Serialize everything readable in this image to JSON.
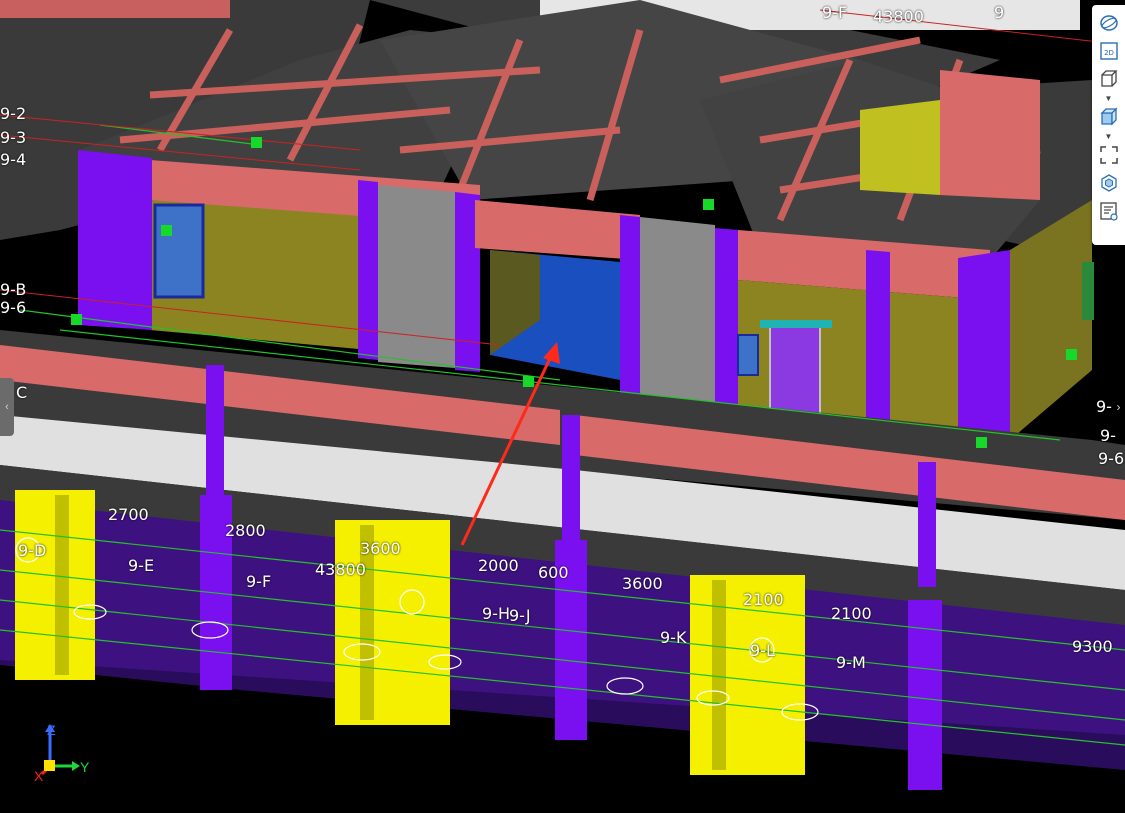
{
  "grid_labels": {
    "top_f": "9-F",
    "top_dim": "43800",
    "top_9": "9",
    "left_2": "9-2",
    "left_3": "9-3",
    "left_4": "9-4",
    "left_b": "9-B",
    "left_6": "9-6",
    "left_c": "C",
    "right_9": "9-",
    "right_9b": "9-",
    "right_6": "9-6",
    "bottom_d": "9-D",
    "bottom_e": "9-E",
    "bottom_f": "9-F",
    "bottom_h": "9-H",
    "bottom_j": "9-J",
    "bottom_k": "9-K",
    "bottom_m": "9-M",
    "bottom_l": "9-L"
  },
  "dimensions": {
    "d2700": "2700",
    "d2800": "2800",
    "d3600a": "3600",
    "d43800": "43800",
    "d2000": "2000",
    "d600": "600",
    "d3600b": "3600",
    "d2100a": "2100",
    "d2100b": "2100",
    "d9300": "9300"
  },
  "toolbar": {
    "items": [
      {
        "icon": "orbit-icon"
      },
      {
        "icon": "view-2d-icon",
        "label": "2D"
      },
      {
        "icon": "cube-wireframe-icon"
      },
      {
        "icon": "cube-shaded-icon"
      },
      {
        "icon": "fit-view-icon"
      },
      {
        "icon": "section-box-icon"
      },
      {
        "icon": "properties-panel-icon"
      }
    ]
  },
  "axes": {
    "z": "Z",
    "y": "Y",
    "x": "X"
  },
  "colors": {
    "background": "#000000",
    "slab": "#3f3f3f",
    "beam": "#d96a6a",
    "column": "#7a10f0",
    "wall": "#8c8420",
    "opening_blue": "#1a4fc0",
    "lower_wall": "#4a1290",
    "yellow_column": "#f4f000",
    "grid_line": "#22c22a",
    "marker": "#17d92a",
    "arrow": "#ff2a1a"
  }
}
